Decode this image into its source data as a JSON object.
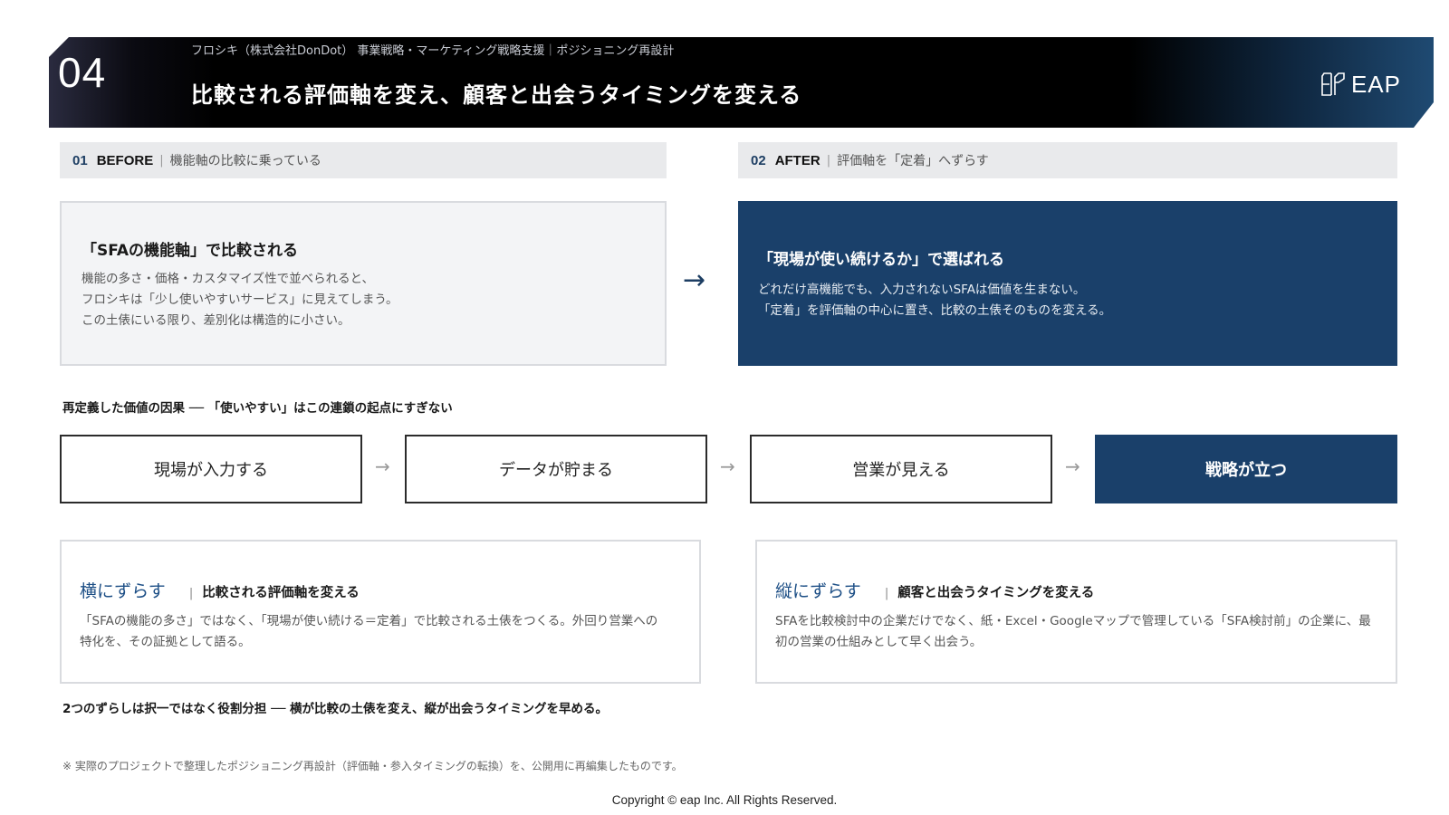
{
  "header": {
    "number": "04",
    "subtitle": "フロシキ（株式会社DonDot） 事業戦略・マーケティング戦略支援｜ポジショニング再設計",
    "title": "比較される評価軸を変え、顧客と出会うタイミングを変える",
    "logo_text": "EAP"
  },
  "before": {
    "num": "01",
    "key": "BEFORE",
    "desc": "機能軸の比較に乗っている",
    "box_title": "「SFAの機能軸」で比較される",
    "lines": [
      "機能の多さ・価格・カスタマイズ性で並べられると、",
      "フロシキは「少し使いやすいサービス」に見えてしまう。",
      "この土俵にいる限り、差別化は構造的に小さい。"
    ]
  },
  "after": {
    "num": "02",
    "key": "AFTER",
    "desc": "評価軸を「定着」へずらす",
    "box_title": "「現場が使い続けるか」で選ばれる",
    "lines": [
      "どれだけ高機能でも、入力されないSFAは価値を生まない。",
      "「定着」を評価軸の中心に置き、比較の土俵そのものを変える。"
    ]
  },
  "arrow": "→",
  "chain": {
    "heading": "再定義した価値の因果 ── 「使いやすい」はこの連鎖の起点にすぎない",
    "steps": [
      "現場が入力する",
      "データが貯まる",
      "営業が見える",
      "戦略が立つ"
    ],
    "arrow": "→"
  },
  "cards": [
    {
      "title": "横にずらす",
      "sub": "比較される評価軸を変える",
      "lines": [
        "「SFAの機能の多さ」ではなく、「現場が使い続ける＝定着」で比較される土俵をつくる。外回り営業への",
        "特化を、その証拠として語る。"
      ]
    },
    {
      "title": "縦にずらす",
      "sub": "顧客と出会うタイミングを変える",
      "lines": [
        "SFAを比較検討中の企業だけでなく、紙・Excel・Googleマップで管理している「SFA検討前」の企業に、最",
        "初の営業の仕組みとして早く出会う。"
      ]
    }
  ],
  "summary": "2つのずらしは択一ではなく役割分担 ── 横が比較の土俵を変え、縦が出会うタイミングを早める。",
  "note": "※ 実際のプロジェクトで整理したポジショニング再設計（評価軸・参入タイミングの転換）を、公開用に再編集したものです。",
  "copyright": "Copyright © eap Inc. All Rights Reserved.",
  "colors": {
    "navy": "#1a406a",
    "accent_blue": "#1d4f86",
    "label_bg": "#e9eaec"
  }
}
